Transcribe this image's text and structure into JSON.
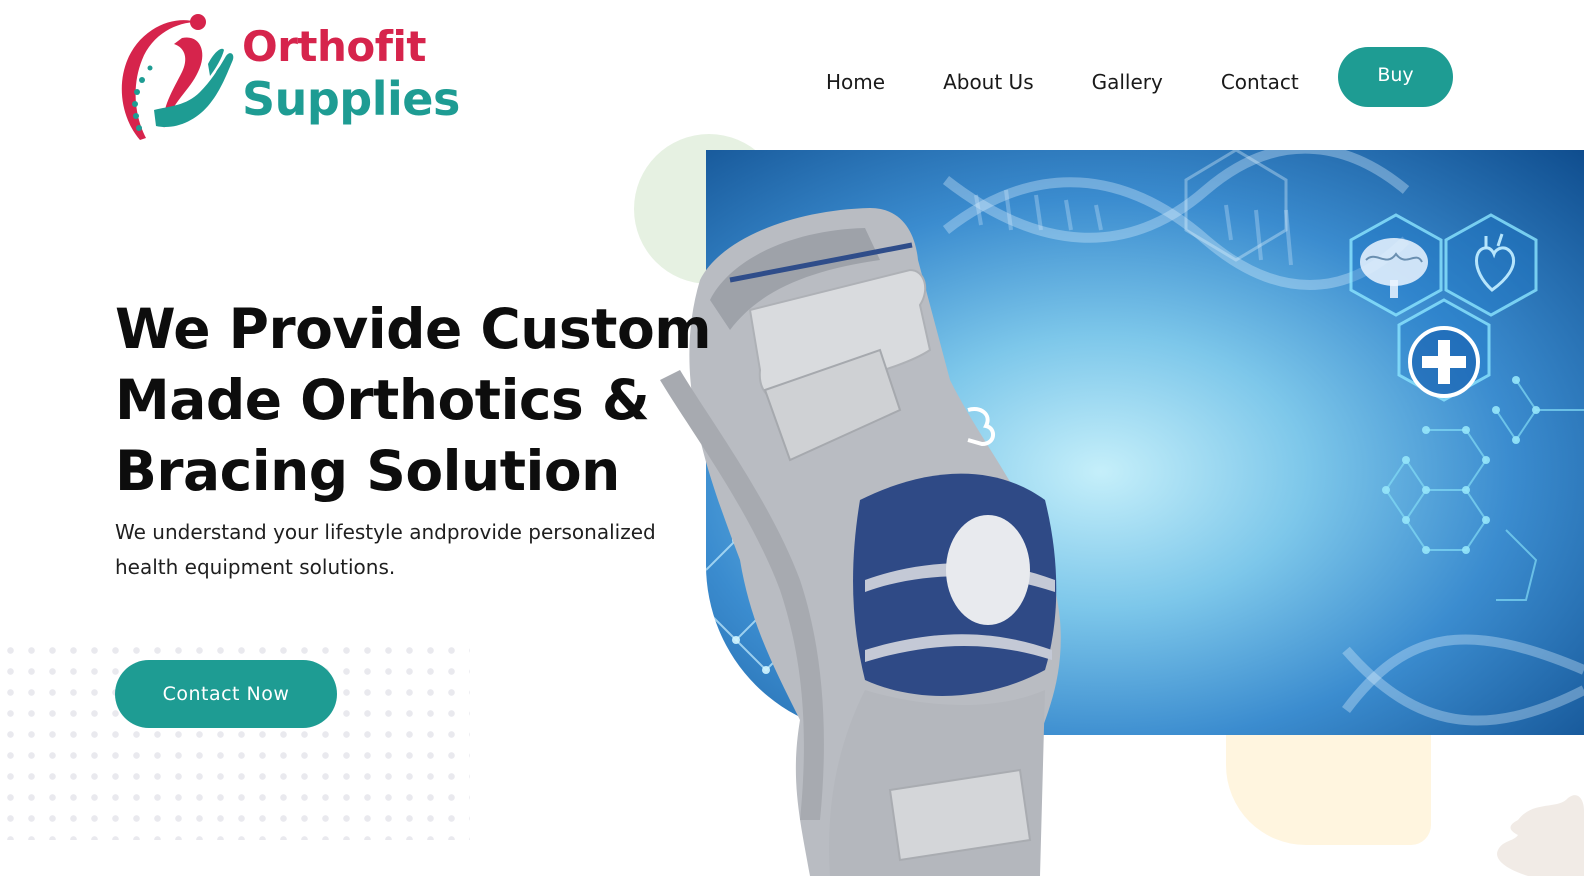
{
  "brand": {
    "name_line1": "Orthofit",
    "name_line2": "Supplies",
    "colors": {
      "primary_red": "#d6244c",
      "primary_teal": "#1e9c93"
    }
  },
  "nav": {
    "items": [
      {
        "label": "Home"
      },
      {
        "label": "About Us"
      },
      {
        "label": "Gallery"
      },
      {
        "label": "Contact"
      }
    ],
    "buy_label": "Buy"
  },
  "hero": {
    "headline": "We Provide Custom Made Orthotics & Bracing Solution",
    "subline": "We understand your lifestyle andprovide personalized health equipment solutions.",
    "cta_label": "Contact Now",
    "image_subject": "knee-brace-on-medical-dna-background"
  },
  "icons": {
    "logo": "hand-figure-logo-icon",
    "brain": "brain-icon",
    "heart": "heart-icon",
    "plus": "medical-plus-icon"
  }
}
